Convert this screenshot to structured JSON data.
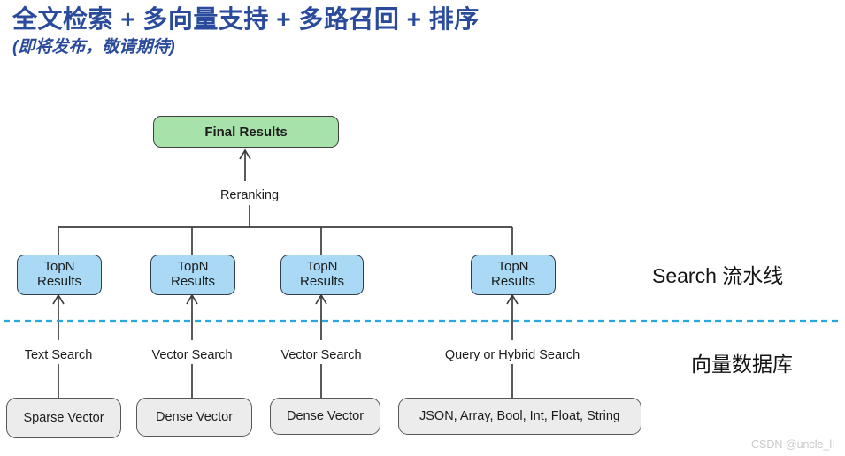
{
  "title": {
    "main": "全文检索 + 多向量支持 + 多路召回 + 排序",
    "sub": "(即将发布，敬请期待)",
    "color": "#2a4b9b"
  },
  "diagram": {
    "final_node": {
      "label": "Final Results",
      "fill": "#a8e2ab",
      "stroke": "#3f3f3f"
    },
    "reranking_label": "Reranking",
    "topn_nodes": [
      {
        "line1": "TopN",
        "line2": "Results"
      },
      {
        "line1": "TopN",
        "line2": "Results"
      },
      {
        "line1": "TopN",
        "line2": "Results"
      },
      {
        "line1": "TopN",
        "line2": "Results"
      }
    ],
    "topn_fill": "#a9d9f4",
    "topn_stroke": "#2f3f4d",
    "search_labels": [
      "Text Search",
      "Vector Search",
      "Vector Search",
      "Query or Hybrid Search"
    ],
    "data_nodes": [
      "Sparse Vector",
      "Dense Vector",
      "Dense Vector",
      "JSON, Array, Bool, Int, Float, String"
    ],
    "data_fill": "#ececec",
    "data_stroke": "#53585a",
    "divider_color": "#29a8dd",
    "edge_color": "#3c3c3c"
  },
  "zones": {
    "upper": "Search 流水线",
    "lower": "向量数据库"
  },
  "watermark": "CSDN @uncle_ll"
}
